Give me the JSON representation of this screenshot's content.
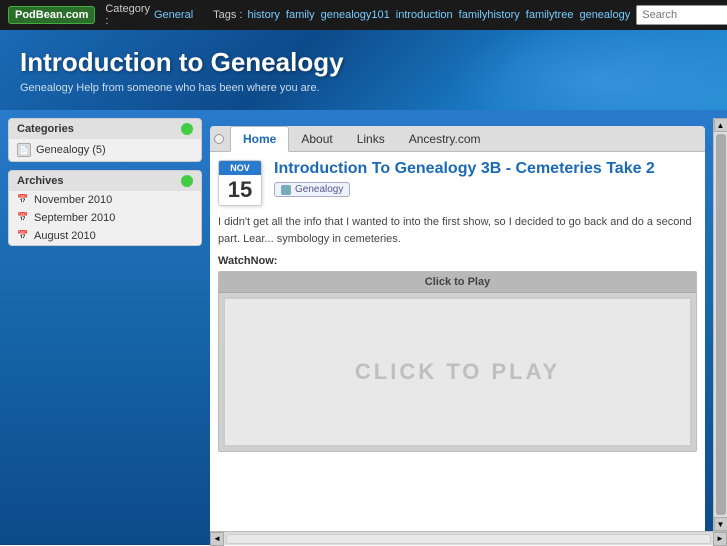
{
  "topbar": {
    "logo": "PodBean.com",
    "category_label": "Category :",
    "category_value": "General",
    "tags_label": "Tags :",
    "tags": [
      "history",
      "family",
      "genealogy101",
      "introduction",
      "familyhistory",
      "familytree",
      "genealogy"
    ],
    "search_placeholder": "Search"
  },
  "hero": {
    "title": "Introduction to Genealogy",
    "subtitle": "Genealogy Help from someone who has been where you are."
  },
  "sidebar": {
    "categories_header": "Categories",
    "categories_items": [
      {
        "label": "Genealogy (5)"
      }
    ],
    "archives_header": "Archives",
    "archives_items": [
      {
        "label": "November 2010"
      },
      {
        "label": "September 2010"
      },
      {
        "label": "August 2010"
      }
    ]
  },
  "nav": {
    "tabs": [
      "Home",
      "About",
      "Links",
      "Ancestry.com"
    ],
    "active_tab": "Home"
  },
  "post": {
    "date_month": "Nov",
    "date_day": "15",
    "title": "Introduction To Genealogy 3B - Cemeteries Take 2",
    "category": "Genealogy",
    "excerpt": "I didn't get all the info that I wanted to into the first show, so I decided to go back and do a second part. Lear... symbology in cemeteries.",
    "watch_now_label": "WatchNow:",
    "player_click_to_play": "Click to Play",
    "player_overlay": "CLICK TO PLAY"
  },
  "scrollbar": {
    "up_arrow": "▲",
    "down_arrow": "▼",
    "left_arrow": "◄",
    "right_arrow": "►"
  }
}
